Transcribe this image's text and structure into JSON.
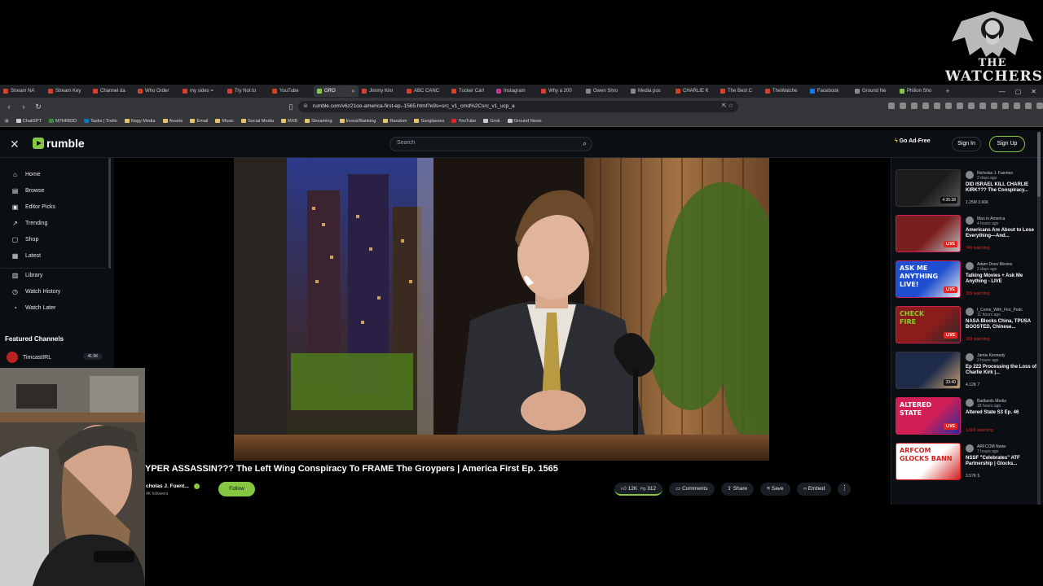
{
  "watermark": {
    "line1": "THE",
    "line2": "WATCHERS"
  },
  "browser": {
    "tabs": [
      {
        "label": "Stream NA",
        "color": "#d6402b"
      },
      {
        "label": "Stream Key",
        "color": "#d6402b"
      },
      {
        "label": "Channel da",
        "color": "#d6402b"
      },
      {
        "label": "Who Order",
        "color": "#d6402b"
      },
      {
        "label": "my sides =",
        "color": "#d6402b"
      },
      {
        "label": "Try Not to",
        "color": "#d6402b"
      },
      {
        "label": "YouTube",
        "color": "#d6402b"
      },
      {
        "label": "GRO",
        "color": "#85c742",
        "active": true
      },
      {
        "label": "Jimmy Kim",
        "color": "#d6402b"
      },
      {
        "label": "ABC CANC",
        "color": "#d6402b"
      },
      {
        "label": "Tucker Carl",
        "color": "#d6402b"
      },
      {
        "label": "Instagram",
        "color": "#c13584"
      },
      {
        "label": "Why a 200",
        "color": "#d6402b"
      },
      {
        "label": "Owen Shro",
        "color": "#888888"
      },
      {
        "label": "Media pos",
        "color": "#888888"
      },
      {
        "label": "CHARLIE K",
        "color": "#d6402b"
      },
      {
        "label": "The Best C",
        "color": "#d6402b"
      },
      {
        "label": "TheWatche",
        "color": "#d6402b"
      },
      {
        "label": "Facebook",
        "color": "#1877f2"
      },
      {
        "label": "Ground Ne",
        "color": "#888888"
      },
      {
        "label": "Philion Sho",
        "color": "#85c742"
      }
    ],
    "url": "rumble.com/v6z21oo-america-first-ep.-1565.html?e9s=src_v1_cmd%2Csrc_v1_ucp_a",
    "bookmarks": [
      {
        "label": "ChatGPT",
        "color": "#cccccc"
      },
      {
        "label": "M7HR82D",
        "color": "#3d8b40"
      },
      {
        "label": "Tasks | Trello",
        "color": "#0079bf"
      },
      {
        "label": "Nagy Media",
        "color": "#e8c46a"
      },
      {
        "label": "Assets",
        "color": "#e8c46a"
      },
      {
        "label": "Email",
        "color": "#e8c46a"
      },
      {
        "label": "Music",
        "color": "#e8c46a"
      },
      {
        "label": "Social Media",
        "color": "#e8c46a"
      },
      {
        "label": "MXB",
        "color": "#e8c46a"
      },
      {
        "label": "Streaming",
        "color": "#e8c46a"
      },
      {
        "label": "Invest/Banking",
        "color": "#e8c46a"
      },
      {
        "label": "Random",
        "color": "#e8c46a"
      },
      {
        "label": "Sunglasses",
        "color": "#e8c46a"
      },
      {
        "label": "YouTube",
        "color": "#e02424"
      },
      {
        "label": "Grok",
        "color": "#cccccc"
      },
      {
        "label": "Ground News",
        "color": "#cccccc"
      }
    ]
  },
  "header": {
    "logo_text": "rumble",
    "search_placeholder": "Search",
    "go_ad_free": "Go Ad-Free",
    "sign_in": "Sign In",
    "sign_up": "Sign Up"
  },
  "sidebar": {
    "items": [
      {
        "label": "Home",
        "icon": "home-icon"
      },
      {
        "label": "Browse",
        "icon": "browse-icon"
      },
      {
        "label": "Editor Picks",
        "icon": "editor-picks-icon"
      },
      {
        "label": "Trending",
        "icon": "trending-icon"
      },
      {
        "label": "Shop",
        "icon": "shop-icon"
      },
      {
        "label": "Latest",
        "icon": "latest-icon"
      },
      {
        "label": "Library",
        "icon": "library-icon"
      },
      {
        "label": "Watch History",
        "icon": "history-icon"
      },
      {
        "label": "Watch Later",
        "icon": "watch-later-icon"
      }
    ],
    "featured_heading": "Featured Channels",
    "featured": [
      {
        "label": "TimcastIRL",
        "count": "41.5K"
      }
    ]
  },
  "video": {
    "title": "YPER ASSASSIN??? The Left Wing Conspiracy To FRAME The Groypers | America First Ep. 1565",
    "channel": "cholas J. Fuent...",
    "followers": "4K followers",
    "follow": "Follow",
    "likes": "12K",
    "dislikes": "312",
    "comments": "Comments",
    "share": "Share",
    "save": "Save",
    "embed": "Embed"
  },
  "related": [
    {
      "channel": "Nicholas J. Fuentes",
      "time": "2 days ago",
      "title": "DID ISRAEL KILL CHARLIE KIRK??? The Conspiracy...",
      "meta": "1.25M   3.66K",
      "duration": "4:35:38",
      "live": false,
      "watching": ""
    },
    {
      "channel": "Man in America",
      "time": "4 hours ago",
      "title": "Americans Are About to Lose Everything—And...",
      "meta": "",
      "duration": "",
      "live": true,
      "watching": "740 watching"
    },
    {
      "channel": "Adam Does Movies",
      "time": "2 days ago",
      "title": "Talking Movies + Ask Me Anything - LIVE",
      "meta": "",
      "duration": "",
      "live": true,
      "watching": "155 watching"
    },
    {
      "channel": "I_Come_With_Fire_Podc",
      "time": "11 hours ago",
      "title": "NASA Blocks China, TPUSA BOOSTED, Chinese...",
      "meta": "",
      "duration": "",
      "live": true,
      "watching": "103 watching"
    },
    {
      "channel": "Jamie Kennedy",
      "time": "3 hours ago",
      "title": "Ep 222 Processing the Loss of Charlie Kirk |...",
      "meta": "4.12K   7",
      "duration": "33:40",
      "live": false,
      "watching": ""
    },
    {
      "channel": "Badlands Media",
      "time": "18 hours ago",
      "title": "Altered State S3 Ep. 46",
      "meta": "",
      "duration": "",
      "live": true,
      "watching": "1,665 watching"
    },
    {
      "channel": "ARFCOM News",
      "time": "7 hours ago",
      "title": "NSSF \"Celebrates\" ATF Partnership | Glocks...",
      "meta": "3.57K   5",
      "duration": "",
      "live": false,
      "watching": ""
    }
  ],
  "related_thumb_text": [
    "ASK ME",
    "ANYTHING",
    "LIVE!",
    "CHECK",
    "FIRE",
    "ALTERED",
    "STATE",
    "ARFCOM",
    "GLOCKS BANN"
  ],
  "colors": {
    "accent": "#85c742",
    "live": "#e02424",
    "background": "#0b0f13"
  }
}
